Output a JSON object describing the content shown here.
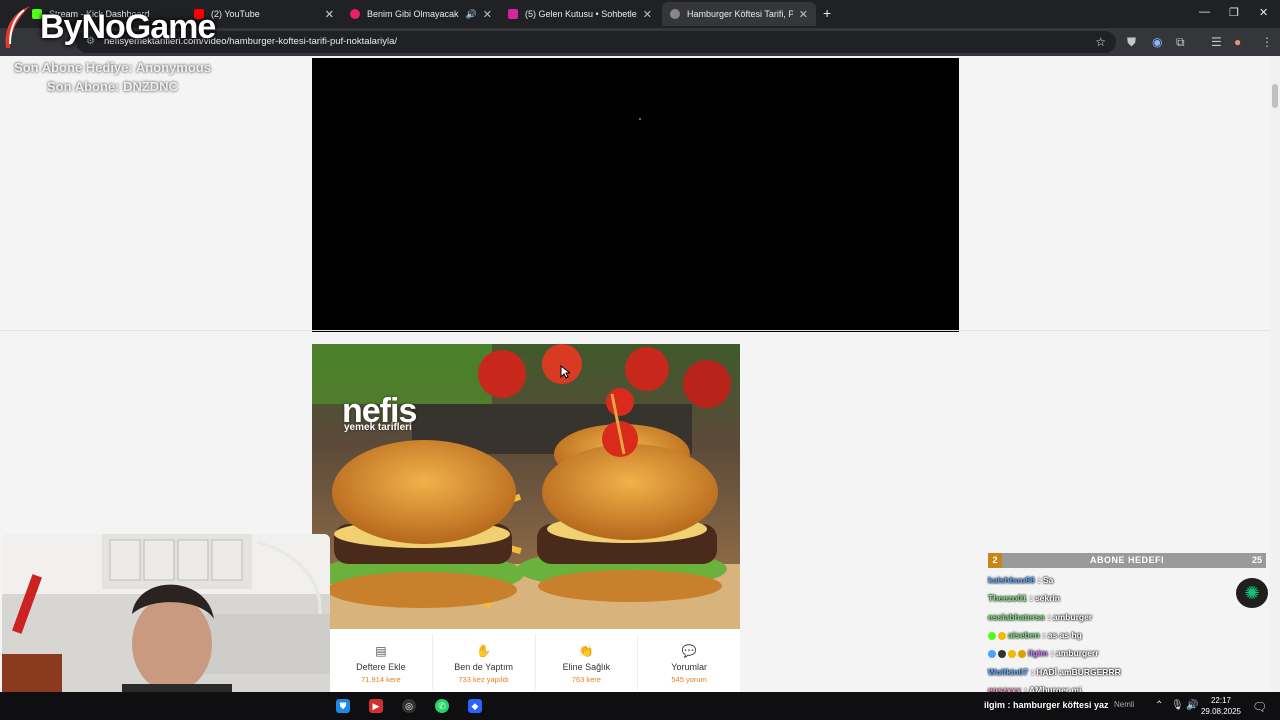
{
  "tabs": [
    {
      "title": "Stream - Kick Dashboard",
      "favicon_color": "#53fc18"
    },
    {
      "title": "(2) YouTube",
      "favicon_color": "#ff0000"
    },
    {
      "title": "Benim Gibi Olmayacak (feat.",
      "favicon_color": "#e91e63",
      "audio": true
    },
    {
      "title": "(5) Gelen Kutusu • Sohbetler",
      "favicon_color": "#d6249f"
    },
    {
      "title": "Hamburger Köftesi Tarifi, Püf N",
      "favicon_color": "#888888",
      "active": true
    }
  ],
  "new_tab": "+",
  "url": "nefisyemektarifleri.com/video/hamburger-koftesi-tarifi-puf-noktalariyla/",
  "overlay": {
    "logo": "ByNoGame",
    "last_donation": "Son Abone Hediye: Anonymous",
    "last_sub": "Son Abone: DNZDNC"
  },
  "recipe": {
    "brand": "nefis",
    "brand_sub": "yemek tarifleri",
    "actions": [
      {
        "label": "Deftere Ekle",
        "count": "71.914 kere",
        "icon": "notebook-icon"
      },
      {
        "label": "Ben de Yaptım",
        "count": "733 kez yapıldı",
        "icon": "cooking-hand-icon"
      },
      {
        "label": "Eline Sağlık",
        "count": "763 kere",
        "icon": "clap-icon"
      },
      {
        "label": "Yorumlar",
        "count": "545 yorum",
        "icon": "comment-icon"
      }
    ]
  },
  "goal": {
    "current": "2",
    "title": "ABONE HEDEFI",
    "target": "25"
  },
  "chat": [
    {
      "user": "kalshbuu66",
      "msg": ": Sa",
      "color": "#5aa9ff"
    },
    {
      "user": "Theezo01",
      "msg": ": sekrin",
      "color": "#7ee07e"
    },
    {
      "user": "esslabhaterss",
      "msg": ": amburger",
      "color": "#7ee07e"
    },
    {
      "user": "aiseben",
      "msg": ": as as hg",
      "color": "#7ee07e"
    },
    {
      "user": "ilgim",
      "msg": ": amburgerr",
      "color": "#c77dff"
    },
    {
      "user": "Wolfkin07",
      "msg": ": HADİ amBURGERRR",
      "color": "#5aa9ff"
    },
    {
      "user": "enszxxx",
      "msg": ": AMburger mi",
      "color": "#ff9ecf"
    }
  ],
  "ticker": "ilgim : hamburger köftesi yaz",
  "weather": "Nemli",
  "clock": {
    "time": "22:17",
    "date": "29.08.2025"
  }
}
